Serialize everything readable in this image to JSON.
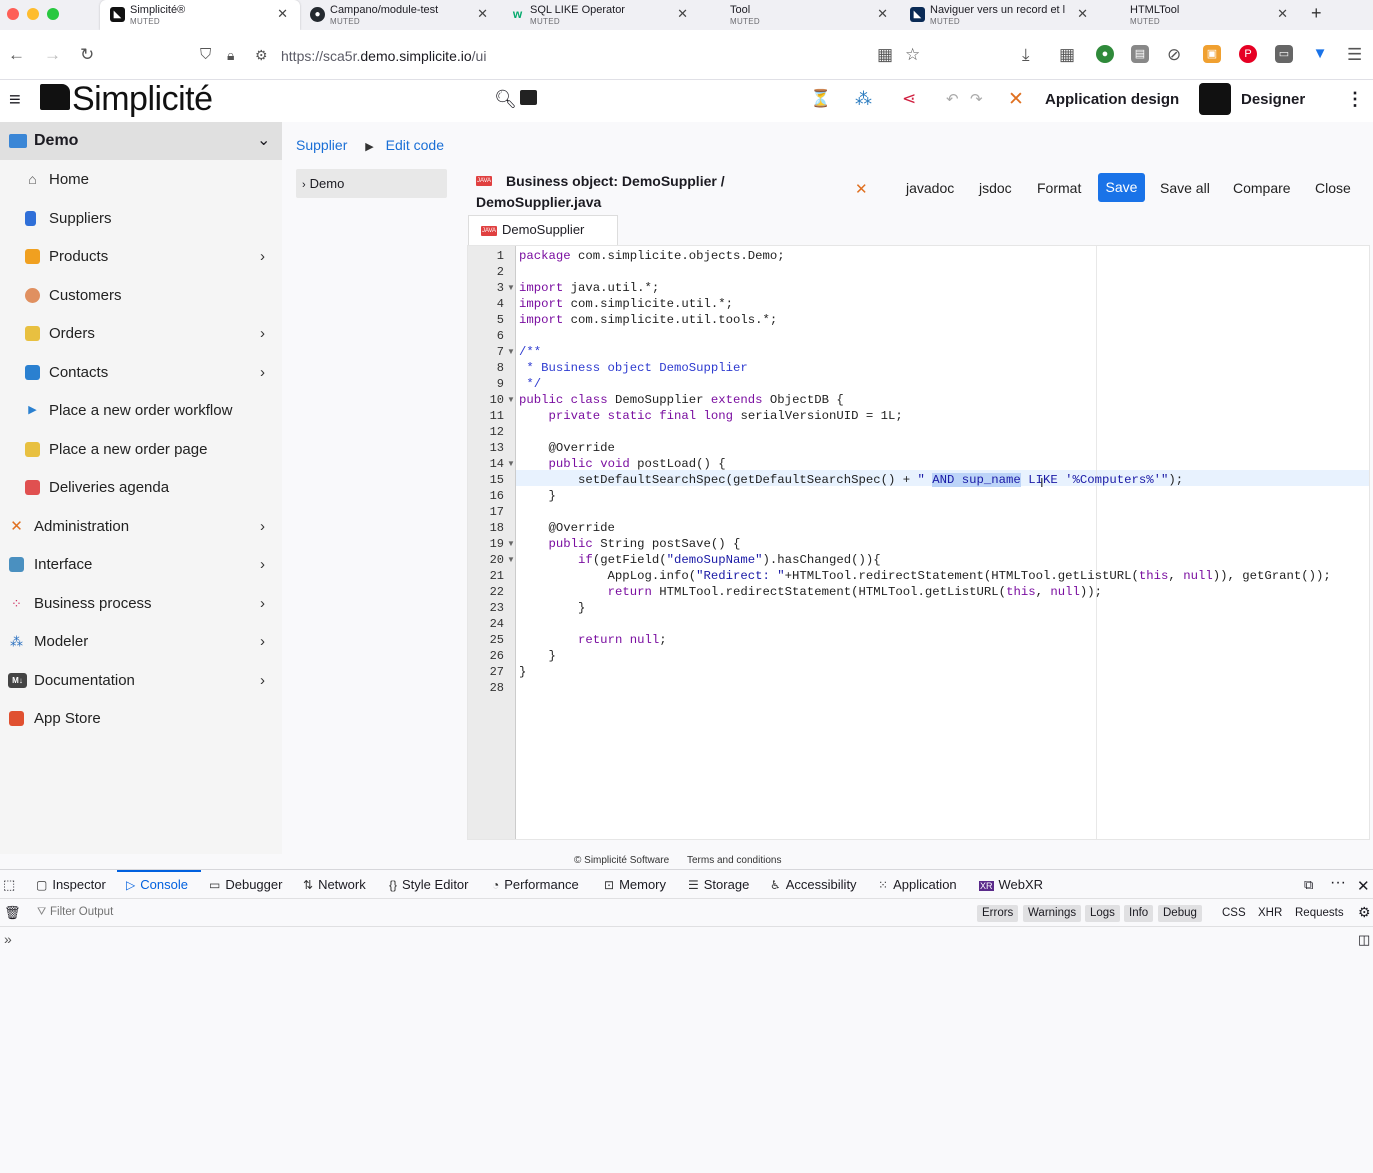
{
  "browser": {
    "tabs": [
      {
        "title": "Simplicité®",
        "sub": "MUTED",
        "icon": "simplicite-favicon-icon",
        "active": true
      },
      {
        "title": "Campano/module-test",
        "sub": "MUTED",
        "icon": "github-icon"
      },
      {
        "title": "SQL LIKE Operator",
        "sub": "MUTED",
        "icon": "w3schools-icon"
      },
      {
        "title": "Tool",
        "sub": "MUTED",
        "icon": ""
      },
      {
        "title": "Naviguer vers un record et l",
        "sub": "MUTED",
        "icon": "simplicite-favicon-icon"
      },
      {
        "title": "HTMLTool",
        "sub": "MUTED",
        "icon": ""
      }
    ],
    "url_prefix": "https://sca5r.",
    "url_host": "demo.simplicite.io",
    "url_path": "/ui"
  },
  "app": {
    "logo": "Simplicité",
    "header_right_label": "Application design",
    "user_label": "Designer"
  },
  "sidebar": {
    "scope": "Demo",
    "items": [
      {
        "label": "Home",
        "icon": "home-icon",
        "chevron": false
      },
      {
        "label": "Suppliers",
        "icon": "building-icon",
        "chevron": false
      },
      {
        "label": "Products",
        "icon": "box-icon",
        "chevron": true
      },
      {
        "label": "Customers",
        "icon": "people-icon",
        "chevron": false
      },
      {
        "label": "Orders",
        "icon": "folder-icon",
        "chevron": true
      },
      {
        "label": "Contacts",
        "icon": "chat-icon",
        "chevron": true
      },
      {
        "label": "Place a new order workflow",
        "icon": "play-icon",
        "chevron": false
      },
      {
        "label": "Place a new order page",
        "icon": "folder-icon",
        "chevron": false
      },
      {
        "label": "Deliveries agenda",
        "icon": "calendar-icon",
        "chevron": false
      }
    ],
    "sections": [
      {
        "label": "Administration",
        "icon": "tools-icon",
        "chevron": true
      },
      {
        "label": "Interface",
        "icon": "image-icon",
        "chevron": true
      },
      {
        "label": "Business process",
        "icon": "process-icon",
        "chevron": true
      },
      {
        "label": "Modeler",
        "icon": "diagram-icon",
        "chevron": true
      },
      {
        "label": "Documentation",
        "icon": "markdown-icon",
        "chevron": true
      },
      {
        "label": "App Store",
        "icon": "store-icon",
        "chevron": false
      }
    ]
  },
  "breadcrumb": {
    "first": "Supplier",
    "second": "Edit code"
  },
  "tree": {
    "label": "Demo"
  },
  "editor": {
    "title_line1": "Business object: DemoSupplier /",
    "title_line2": "DemoSupplier.java",
    "tab_label": "DemoSupplier",
    "toolbar": {
      "javadoc": "javadoc",
      "jsdoc": "jsdoc",
      "format": "Format",
      "save": "Save",
      "save_all": "Save all",
      "compare": "Compare",
      "close": "Close"
    },
    "line_numbers": [
      "1",
      "2",
      "3",
      "4",
      "5",
      "6",
      "7",
      "8",
      "9",
      "10",
      "11",
      "12",
      "13",
      "14",
      "15",
      "16",
      "17",
      "18",
      "19",
      "20",
      "21",
      "22",
      "23",
      "24",
      "25",
      "26",
      "27",
      "28"
    ],
    "code": [
      "package com.simplicite.objects.Demo;",
      "",
      "import java.util.*;",
      "import com.simplicite.util.*;",
      "import com.simplicite.util.tools.*;",
      "",
      "/**",
      " * Business object DemoSupplier",
      " */",
      "public class DemoSupplier extends ObjectDB {",
      "    private static final long serialVersionUID = 1L;",
      "",
      "    @Override",
      "    public void postLoad() {",
      "        setDefaultSearchSpec(getDefaultSearchSpec() + \" AND sup_name LIKE '%Computers%'\");",
      "    }",
      "",
      "    @Override",
      "    public String postSave() {",
      "        if(getField(\"demoSupName\").hasChanged()){",
      "            AppLog.info(\"Redirect: \"+HTMLTool.redirectStatement(HTMLTool.getListURL(this, null)), getGrant());",
      "            return HTMLTool.redirectStatement(HTMLTool.getListURL(this, null));",
      "        }",
      "",
      "        return null;",
      "    }",
      "}",
      ""
    ]
  },
  "footer": {
    "copyright": "© Simplicité Software",
    "terms": "Terms and conditions"
  },
  "devtools": {
    "tabs": [
      "Inspector",
      "Console",
      "Debugger",
      "Network",
      "Style Editor",
      "Performance",
      "Memory",
      "Storage",
      "Accessibility",
      "Application",
      "WebXR"
    ],
    "active_tab": "Console",
    "filter_placeholder": "Filter Output",
    "levels": [
      "Errors",
      "Warnings",
      "Logs",
      "Info",
      "Debug"
    ],
    "extra_filters": [
      "CSS",
      "XHR",
      "Requests"
    ]
  }
}
